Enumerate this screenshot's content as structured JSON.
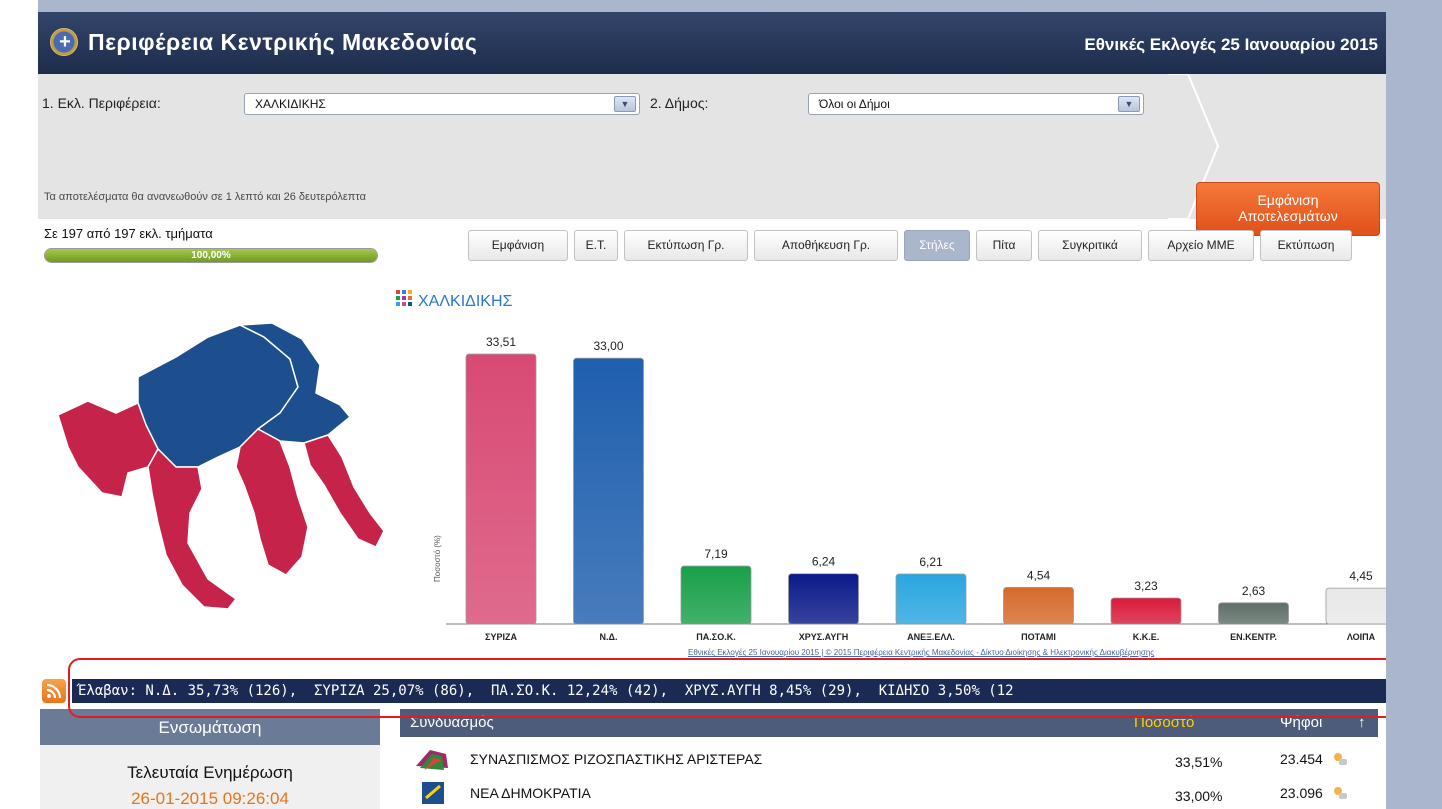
{
  "header": {
    "title": "Περιφέρεια Κεντρικής Μακεδονίας",
    "election": "Εθνικές Εκλογές 25 Ιανουαρίου 2015"
  },
  "filters": {
    "district_label": "1. Εκλ. Περιφέρεια:",
    "district_value": "ΧΑΛΚΙΔΙΚΗΣ",
    "municipality_label": "2. Δήμος:",
    "municipality_value": "Όλοι οι Δήμοι",
    "show_button": [
      "Εμφάνιση",
      "Αποτελεσμάτων"
    ]
  },
  "refresh_note": "Τα αποτελέσματα θα ανανεωθούν σε 1 λεπτό και 26 δευτερόλεπτα",
  "progress": {
    "label": "Σε 197 από 197 εκλ. τμήματα",
    "percent_text": "100,00%",
    "fraction": 1.0
  },
  "toolbar": [
    "Εμφάνιση",
    "Ε.Τ.",
    "Εκτύπωση Γρ.",
    "Αποθήκευση Γρ.",
    "Στήλες",
    "Πίτα",
    "Συγκριτικά",
    "Αρχείο ΜΜΕ",
    "Εκτύπωση"
  ],
  "toolbar_active": "Στήλες",
  "chart_data": {
    "type": "bar",
    "title": "ΧΑΛΚΙΔΙΚΗΣ",
    "ylabel": "Ποσοστό (%)",
    "ylim": [
      0,
      36
    ],
    "categories": [
      "ΣΥΡΙΖΑ",
      "Ν.Δ.",
      "ΠΑ.ΣΟ.Κ.",
      "ΧΡΥΣ.ΑΥΓΗ",
      "ΑΝΕΞ.ΕΛΛ.",
      "ΠΟΤΑΜΙ",
      "Κ.Κ.Ε.",
      "ΕΝ.ΚΕΝΤΡ.",
      "ΛΟΙΠΑ"
    ],
    "values": [
      33.51,
      33.0,
      7.19,
      6.24,
      6.21,
      4.54,
      3.23,
      2.63,
      4.45
    ],
    "value_labels": [
      "33,51",
      "33,00",
      "7,19",
      "6,24",
      "6,21",
      "4,54",
      "3,23",
      "2,63",
      "4,45"
    ],
    "colors": [
      "#d84a74",
      "#1f5fae",
      "#18a04a",
      "#0b1a8a",
      "#2aa6e0",
      "#d66a2c",
      "#d81b3b",
      "#5f6f68",
      "#e8e8e8"
    ],
    "credit": "Εθνικές Εκλογές 25 Ιανουαρίου 2015 | © 2015 Περιφέρεια Κεντρικής Μακεδονίας - Δίκτυο Διοίκησης & Ηλεκτρονικής Διακυβέρνησης"
  },
  "ticker": "Έλαβαν: Ν.Δ. 35,73% (126),  ΣΥΡΙΖΑ 25,07% (86),  ΠΑ.ΣΟ.Κ. 12,24% (42),  ΧΡΥΣ.ΑΥΓΗ 8,45% (29),  ΚΙΔΗΣΟ 3,50% (12",
  "side_panel": {
    "heading": "Ενσωμάτωση",
    "last_update_label": "Τελευταία Ενημέρωση",
    "last_update_value": "26-01-2015 09:26:04"
  },
  "results_table": {
    "headers": [
      "Συνδυασμός",
      "Ποσοστό",
      "Ψήφοι",
      "↑"
    ],
    "rows": [
      {
        "name": "ΣΥΝΑΣΠΙΣΜΟΣ ΡΙΖΟΣΠΑΣΤΙΚΗΣ ΑΡΙΣΤΕΡΑΣ",
        "percent": "33,51%",
        "votes": "23.454"
      },
      {
        "name": "ΝΕΑ ΔΗΜΟΚΡΑΤΙΑ",
        "percent": "33,00%",
        "votes": "23.096"
      }
    ]
  }
}
